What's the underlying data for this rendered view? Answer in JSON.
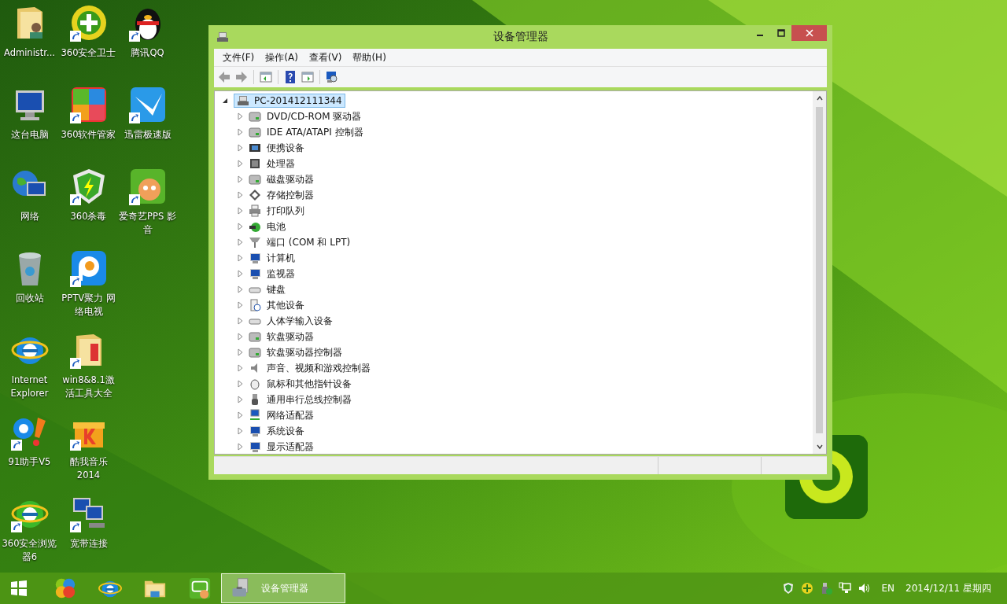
{
  "desktop_icons": [
    [
      {
        "label": "Administr...",
        "shortcut": false
      },
      {
        "label": "360安全卫士",
        "shortcut": true
      },
      {
        "label": "腾讯QQ",
        "shortcut": true
      }
    ],
    [
      {
        "label": "这台电脑",
        "shortcut": false
      },
      {
        "label": "360软件管家",
        "shortcut": true
      },
      {
        "label": "迅雷极速版",
        "shortcut": true
      }
    ],
    [
      {
        "label": "网络",
        "shortcut": false
      },
      {
        "label": "360杀毒",
        "shortcut": true
      },
      {
        "label": "爱奇艺PPS 影音",
        "shortcut": true
      }
    ],
    [
      {
        "label": "回收站",
        "shortcut": false
      },
      {
        "label": "PPTV聚力 网络电视",
        "shortcut": true
      }
    ],
    [
      {
        "label": "Internet Explorer",
        "shortcut": false
      },
      {
        "label": "win8&8.1激活工具大全",
        "shortcut": true
      }
    ],
    [
      {
        "label": "91助手V5",
        "shortcut": true
      },
      {
        "label": "酷我音乐2014",
        "shortcut": true
      }
    ],
    [
      {
        "label": "360安全浏览器6",
        "shortcut": true
      },
      {
        "label": "宽带连接",
        "shortcut": true
      }
    ]
  ],
  "window": {
    "title": "设备管理器",
    "menu": [
      "文件(F)",
      "操作(A)",
      "查看(V)",
      "帮助(H)"
    ],
    "tree": {
      "label": "PC-201412111344",
      "expanded": true,
      "selected": true,
      "children": [
        {
          "label": "DVD/CD-ROM 驱动器",
          "expanded": false,
          "selected": false
        },
        {
          "label": "IDE ATA/ATAPI 控制器",
          "expanded": false,
          "selected": false
        },
        {
          "label": "便携设备",
          "expanded": false,
          "selected": false
        },
        {
          "label": "处理器",
          "expanded": false,
          "selected": false
        },
        {
          "label": "磁盘驱动器",
          "expanded": false,
          "selected": false
        },
        {
          "label": "存储控制器",
          "expanded": false,
          "selected": false
        },
        {
          "label": "打印队列",
          "expanded": false,
          "selected": false
        },
        {
          "label": "电池",
          "expanded": false,
          "selected": false
        },
        {
          "label": "端口 (COM 和 LPT)",
          "expanded": false,
          "selected": false
        },
        {
          "label": "计算机",
          "expanded": false,
          "selected": false
        },
        {
          "label": "监视器",
          "expanded": false,
          "selected": false
        },
        {
          "label": "键盘",
          "expanded": false,
          "selected": false
        },
        {
          "label": "其他设备",
          "expanded": false,
          "selected": false
        },
        {
          "label": "人体学输入设备",
          "expanded": false,
          "selected": false
        },
        {
          "label": "软盘驱动器",
          "expanded": false,
          "selected": false
        },
        {
          "label": "软盘驱动器控制器",
          "expanded": false,
          "selected": false
        },
        {
          "label": "声音、视频和游戏控制器",
          "expanded": false,
          "selected": false
        },
        {
          "label": "鼠标和其他指针设备",
          "expanded": false,
          "selected": false
        },
        {
          "label": "通用串行总线控制器",
          "expanded": false,
          "selected": false
        },
        {
          "label": "网络适配器",
          "expanded": false,
          "selected": false
        },
        {
          "label": "系统设备",
          "expanded": false,
          "selected": false
        },
        {
          "label": "显示适配器",
          "expanded": false,
          "selected": false
        }
      ]
    }
  },
  "taskbar": {
    "task": {
      "label": "设备管理器",
      "selected": true
    },
    "language": "EN",
    "date": "2014/12/11 星期四"
  }
}
